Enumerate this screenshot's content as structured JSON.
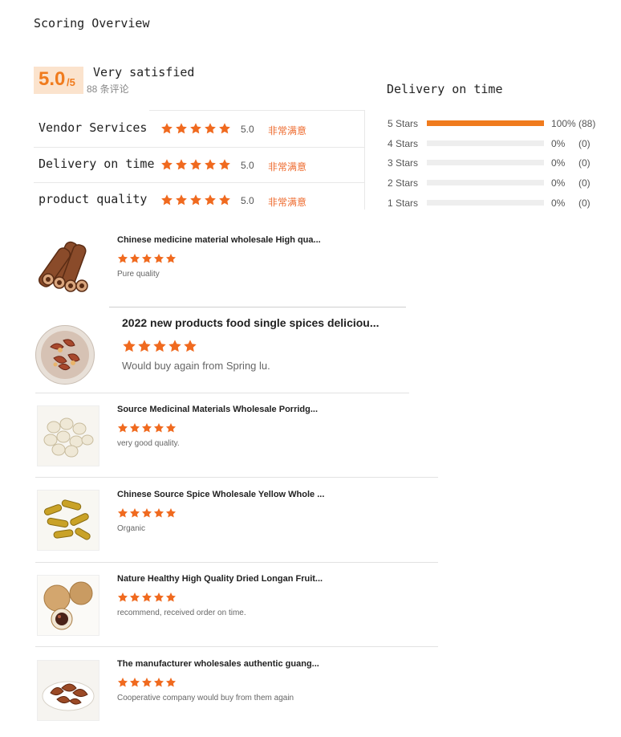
{
  "overview": {
    "title": "Scoring Overview",
    "score": "5.0",
    "score_max": "/5",
    "satisfaction": "Very satisfied",
    "review_count": "88 条评论"
  },
  "categories": [
    {
      "name": "Vendor Services",
      "score": "5.0",
      "desc": "非常满意"
    },
    {
      "name": "Delivery on time",
      "score": "5.0",
      "desc": "非常满意"
    },
    {
      "name": "product quality",
      "score": "5.0",
      "desc": "非常满意"
    }
  ],
  "distribution": {
    "title": "Delivery on time",
    "rows": [
      {
        "label": "5 Stars",
        "percent": "100%",
        "count": "(88)",
        "fraction": 1.0
      },
      {
        "label": "4 Stars",
        "percent": "0%",
        "count": "(0)",
        "fraction": 0
      },
      {
        "label": "3 Stars",
        "percent": "0%",
        "count": "(0)",
        "fraction": 0
      },
      {
        "label": "2 Stars",
        "percent": "0%",
        "count": "(0)",
        "fraction": 0
      },
      {
        "label": "1 Stars",
        "percent": "0%",
        "count": "(0)",
        "fraction": 0
      }
    ]
  },
  "reviews": [
    {
      "product": "Chinese medicine material wholesale High qua...",
      "comment": "Pure quality",
      "rating": 5,
      "image": "cinnamon-rolls"
    },
    {
      "product": "2022 new products food single spices deliciou...",
      "comment": "Would buy again from Spring lu.",
      "rating": 5,
      "image": "dried-spice-bowl"
    },
    {
      "product": "Source Medicinal Materials Wholesale Porridg...",
      "comment": "very good quality.",
      "rating": 5,
      "image": "white-lotus-seeds"
    },
    {
      "product": "Chinese Source Spice Wholesale Yellow Whole ...",
      "comment": "Organic",
      "rating": 5,
      "image": "turmeric-roots"
    },
    {
      "product": "Nature Healthy High Quality Dried Longan Fruit...",
      "comment": "recommend, received order on time.",
      "rating": 5,
      "image": "dried-longan"
    },
    {
      "product": "The manufacturer wholesales authentic guang...",
      "comment": "Cooperative company would buy from them again",
      "rating": 5,
      "image": "dried-peel-plate"
    }
  ],
  "colors": {
    "accent": "#f07b1d",
    "star": "#f06a1f",
    "highlight_bg": "#fbe3cd",
    "desc_text": "#ee6b2f"
  },
  "icons": {
    "star": "star-icon"
  }
}
